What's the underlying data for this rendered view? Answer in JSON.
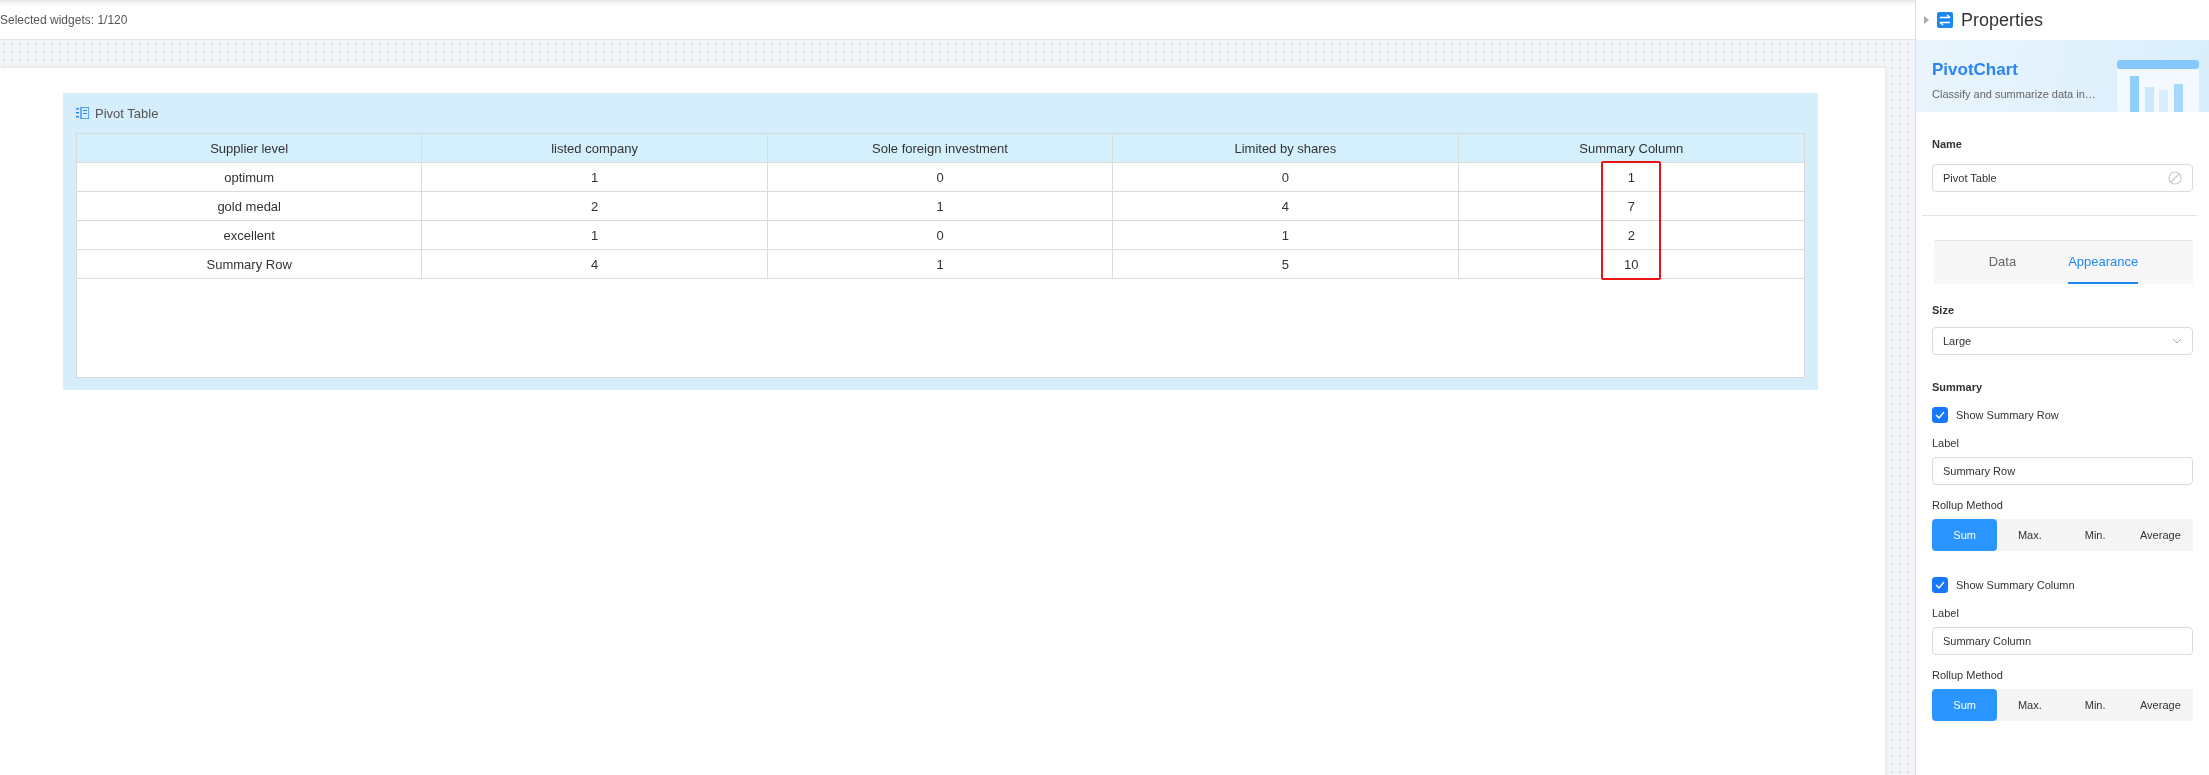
{
  "status_bar": {
    "selected_text": "Selected widgets: 1/120"
  },
  "widget": {
    "title": "Pivot Table",
    "table": {
      "columns": [
        {
          "label": "Supplier level",
          "highlighted": false
        },
        {
          "label": "listed company",
          "highlighted": false
        },
        {
          "label": "Sole foreign investment",
          "highlighted": false
        },
        {
          "label": "Limited by shares",
          "highlighted": false
        },
        {
          "label": "Summary Column",
          "highlighted": true
        }
      ],
      "rows": [
        [
          "optimum",
          "1",
          "0",
          "0",
          "1"
        ],
        [
          "gold medal",
          "2",
          "1",
          "4",
          "7"
        ],
        [
          "excellent",
          "1",
          "0",
          "1",
          "2"
        ],
        [
          "Summary Row",
          "4",
          "1",
          "5",
          "10"
        ]
      ]
    }
  },
  "panel": {
    "title": "Properties",
    "banner": {
      "title": "PivotChart",
      "subtitle": "Classify and summarize data in…"
    },
    "name_label": "Name",
    "name_value": "Pivot Table",
    "tabs": [
      {
        "label": "Data",
        "selected": false
      },
      {
        "label": "Appearance",
        "selected": true
      }
    ],
    "size_label": "Size",
    "size_value": "Large",
    "summary_label": "Summary",
    "summaries": [
      {
        "toggle": "Show Summary Row",
        "checked": true,
        "label_caption": "Label",
        "label_value": "Summary Row",
        "method_caption": "Rollup Method",
        "methods": [
          {
            "label": "Sum",
            "selected": true
          },
          {
            "label": "Max.",
            "selected": false
          },
          {
            "label": "Min.",
            "selected": false
          },
          {
            "label": "Average",
            "selected": false
          }
        ]
      },
      {
        "toggle": "Show Summary Column",
        "checked": true,
        "label_caption": "Label",
        "label_value": "Summary Column",
        "method_caption": "Rollup Method",
        "methods": [
          {
            "label": "Sum",
            "selected": true
          },
          {
            "label": "Max.",
            "selected": false
          },
          {
            "label": "Min.",
            "selected": false
          },
          {
            "label": "Average",
            "selected": false
          }
        ]
      }
    ]
  }
}
